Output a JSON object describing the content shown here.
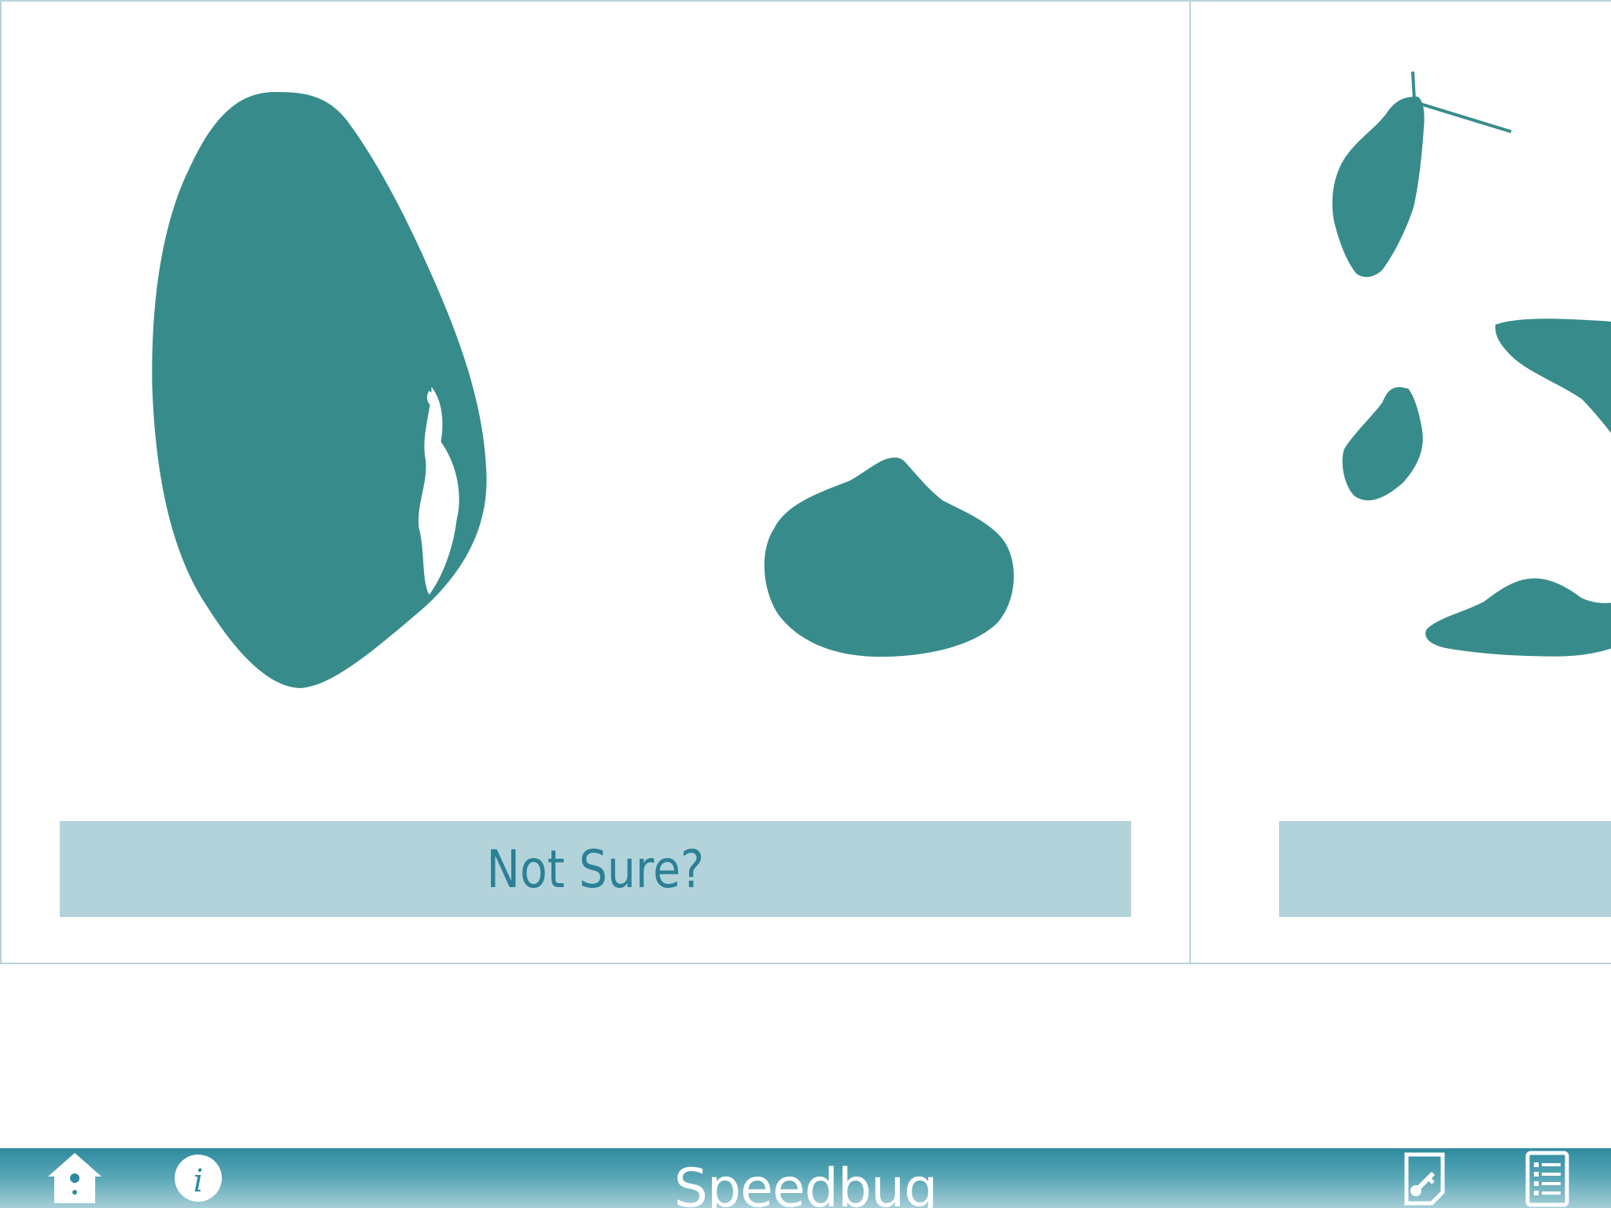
{
  "app": {
    "title": "Speedbug",
    "accent_color": "#378c8b",
    "bar_color": "#2e8ba0",
    "button_color": "#b3d3da",
    "button_text_color": "#2b8096"
  },
  "cards": [
    {
      "button_label": "Not Sure?",
      "images": [
        "large-oval-shell-silhouette",
        "round-conical-shell-silhouette"
      ]
    },
    {
      "button_label": "",
      "images": [
        "small-elongated-shell-silhouette",
        "partial-shell-silhouette",
        "small-oval-shell-silhouette",
        "flat-conical-shell-silhouette"
      ]
    }
  ],
  "toolbar": {
    "left_icons": [
      "home-icon",
      "info-icon"
    ],
    "right_icons": [
      "key-note-icon",
      "list-icon"
    ]
  }
}
